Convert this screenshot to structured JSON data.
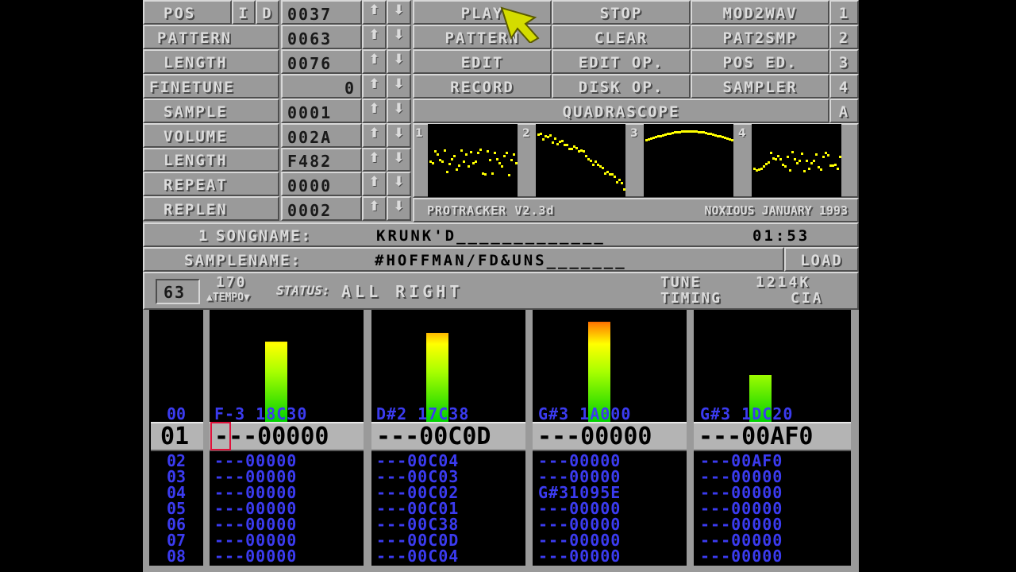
{
  "params": {
    "pos_label": "POS",
    "i_label": "I",
    "d_label": "D",
    "pos_value": "0037",
    "pattern_label": "PATTERN",
    "pattern_value": "0063",
    "length_label": "LENGTH",
    "length_value": "0076",
    "finetune_label": "FINETUNE",
    "finetune_value": "0",
    "sample_label": "SAMPLE",
    "sample_value": "0001",
    "volume_label": "VOLUME",
    "volume_value": "002A",
    "slength_label": "LENGTH",
    "slength_value": "F482",
    "repeat_label": "REPEAT",
    "repeat_value": "0000",
    "replen_label": "REPLEN",
    "replen_value": "0002"
  },
  "arrows": {
    "up": "⬆",
    "down": "⬇"
  },
  "buttons": {
    "play": "PLAY",
    "stop": "STOP",
    "mod2wav": "MOD2WAV",
    "one": "1",
    "pattern": "PATTERN",
    "clear": "CLEAR",
    "pat2smp": "PAT2SMP",
    "two": "2",
    "edit": "EDIT",
    "edit_op": "EDIT OP.",
    "pos_ed": "POS ED.",
    "three": "3",
    "record": "RECORD",
    "disk_op": "DISK OP.",
    "sampler": "SAMPLER",
    "four": "4",
    "quadrascope": "QUADRASCOPE",
    "a": "A"
  },
  "scopes": {
    "n1": "1",
    "n2": "2",
    "n3": "3",
    "n4": "4"
  },
  "footer": {
    "version": "PROTRACKER V2.3d",
    "credit": "NOXIOUS JANUARY 1993"
  },
  "song": {
    "prefix": "1",
    "label": "SONGNAME:",
    "name": "KRUNK'D_____________",
    "time": "01:53"
  },
  "samplename": {
    "label": "SAMPLENAME:",
    "name": "#HOFFMAN/FD&UNS_______",
    "load": "LOAD"
  },
  "status": {
    "octave": "63",
    "tempo_value": "170",
    "tempo_label": "TEMPO",
    "status_label": "STATUS:",
    "status_text": "ALL RIGHT",
    "tune": "TUNE",
    "timing": "TIMING",
    "mem": "1214K",
    "cia": "CIA"
  },
  "pattern": {
    "row_prev": "00",
    "prev_cells": [
      "F-3 18C30",
      "D#2 17C38",
      "G#3 1A000",
      "G#3 1DC20"
    ],
    "current_row": "01",
    "current_cells": [
      "---00000",
      "---00C0D",
      "---00000",
      "---00AF0"
    ],
    "rows": [
      {
        "num": "02",
        "cells": [
          "---00000",
          "---00C04",
          "---00000",
          "---00AF0"
        ]
      },
      {
        "num": "03",
        "cells": [
          "---00000",
          "---00C03",
          "---00000",
          "---00000"
        ]
      },
      {
        "num": "04",
        "cells": [
          "---00000",
          "---00C02",
          "G#31095E",
          "---00000"
        ]
      },
      {
        "num": "05",
        "cells": [
          "---00000",
          "---00C01",
          "---00000",
          "---00000"
        ]
      },
      {
        "num": "06",
        "cells": [
          "---00000",
          "---00C38",
          "---00000",
          "---00000"
        ]
      },
      {
        "num": "07",
        "cells": [
          "---00000",
          "---00C0D",
          "---00000",
          "---00000"
        ]
      },
      {
        "num": "08",
        "cells": [
          "---00000",
          "---00C04",
          "---00000",
          "---00000"
        ]
      }
    ]
  },
  "vu_levels": [
    0.72,
    0.8,
    0.9,
    0.42
  ],
  "colors": {
    "panel": "#9a9a9a",
    "pattern_text": "#3b3bf0",
    "scope_trace": "#ffff00",
    "cursor": "#ff0000",
    "pointer": "#d8e000"
  }
}
